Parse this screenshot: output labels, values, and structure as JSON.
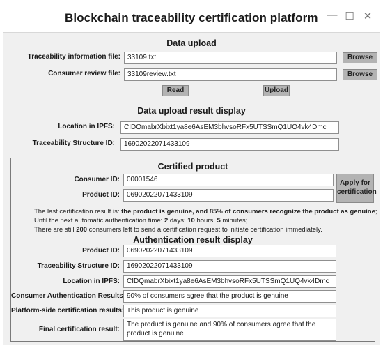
{
  "window": {
    "title": "Blockchain traceability certification platform",
    "controls": {
      "minimize": "—",
      "maximize": "☐",
      "close": "✕"
    }
  },
  "upload": {
    "title": "Data upload",
    "trace_file_label": "Traceability information file:",
    "trace_file_value": "33109.txt",
    "review_file_label": "Consumer review file:",
    "review_file_value": "33109review.txt",
    "browse_label": "Browse",
    "read_label": "Read",
    "upload_label": "Upload"
  },
  "upload_result": {
    "title": "Data upload result display",
    "ipfs_label": "Location in IPFS:",
    "ipfs_value": "CIDQmabrXbixt1ya8e6AsEM3bhvsoRFx5UTSSmQ1UQ4vk4Dmc",
    "structure_label": "Traceability Structure  ID:",
    "structure_value": "16902022071433109"
  },
  "certified": {
    "title": "Certified product",
    "consumer_label": "Consumer  ID:",
    "consumer_value": "00001546",
    "product_label": "Product ID:",
    "product_value": "06902022071433109",
    "apply_label": "Apply for certification",
    "info": {
      "line1_prefix": "The last certification result is: ",
      "line1_bold": "the product is genuine, and 85% of consumers recognize the product as genuine",
      "line1_suffix": ";",
      "line2_prefix": "Until the next automatic authentication time: ",
      "line2_days": "2",
      "line2_days_unit": " days: ",
      "line2_hours": "10",
      "line2_hours_unit": " hours: ",
      "line2_minutes": "5",
      "line2_minutes_unit": " minutes;",
      "line3_prefix": "There are still ",
      "line3_count": "200",
      "line3_suffix": " consumers left to send a certification request to initiate certification immediately."
    }
  },
  "auth_result": {
    "title": "Authentication result display",
    "product_label": "Product ID:",
    "product_value": "06902022071433109",
    "structure_label": "Traceability Structure ID:",
    "structure_value": "16902022071433109",
    "ipfs_label": "Location in IPFS:",
    "ipfs_value": "CIDQmabrXbixt1ya8e6AsEM3bhvsoRFx5UTSSmQ1UQ4vk4Dmc",
    "consumer_auth_label": "Consumer Authentication Results:",
    "consumer_auth_value": "90% of consumers agree that the product is genuine",
    "platform_label": "Platform-side certification results:",
    "platform_value": "This product is genuine",
    "final_label": "Final certification result:",
    "final_value": "The product is genuine and 90% of consumers agree that the product is genuine"
  }
}
